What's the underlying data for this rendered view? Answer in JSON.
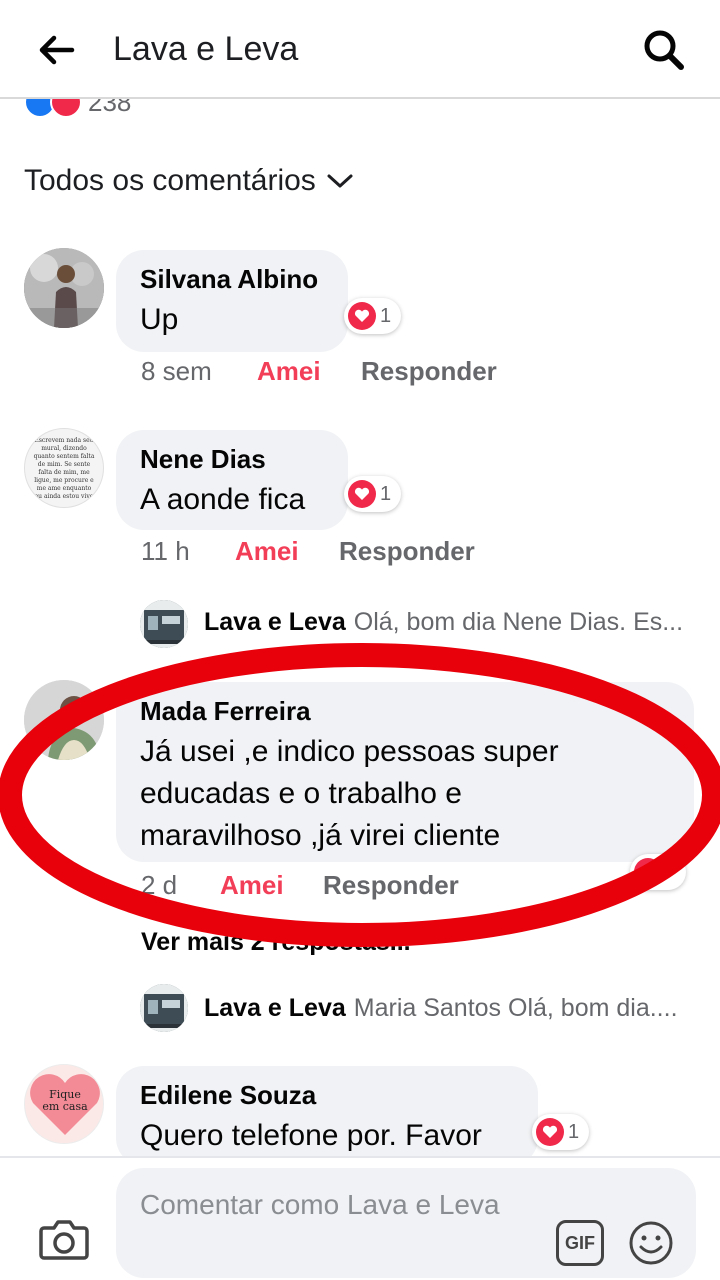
{
  "header": {
    "title": "Lava e Leva"
  },
  "post": {
    "reaction_count": "238"
  },
  "filter": {
    "label": "Todos os comentários"
  },
  "comments": [
    {
      "author": "Silvana Albino",
      "text": "Up",
      "reactions": "1",
      "time": "8 sem",
      "like_label": "Amei",
      "reply_label": "Responder"
    },
    {
      "author": "Nene Dias",
      "text": "A aonde fica",
      "reactions": "1",
      "time": "11 h",
      "like_label": "Amei",
      "reply_label": "Responder",
      "avatar_text": "Escrevem nada seu mural, dizendo quanto sentem falta de mim. Se sente falta de mim, me ligue, me procure e me ame enquanto eu ainda estou vivo",
      "reply_preview": {
        "author": "Lava e Leva",
        "text": "Olá, bom dia Nene Dias. Es..."
      }
    },
    {
      "author": "Mada Ferreira",
      "text_lines": [
        "Já usei ,e indico pessoas super",
        "educadas e o trabalho e",
        "maravilhoso ,já virei cliente"
      ],
      "time": "2 d",
      "like_label": "Amei",
      "reply_label": "Responder",
      "more_replies": "Ver mais 2 respostas...",
      "reply_preview": {
        "author": "Lava e Leva",
        "text": "Maria Santos Olá, bom dia...."
      }
    },
    {
      "author": "Edilene Souza",
      "text": "Quero  telefone por. Favor",
      "reactions": "1",
      "avatar_text": "Fique em casa"
    }
  ],
  "composer": {
    "placeholder": "Comentar como Lava e Leva",
    "gif_label": "GIF"
  },
  "colors": {
    "amei": "#f33e58",
    "annotation": "#e8000b",
    "bubble": "#f0f2f5",
    "like_blue": "#1877f2"
  },
  "icons": [
    "back-arrow-icon",
    "search-icon",
    "chevron-down-icon",
    "heart-icon",
    "camera-icon",
    "gif-icon",
    "smiley-icon"
  ]
}
